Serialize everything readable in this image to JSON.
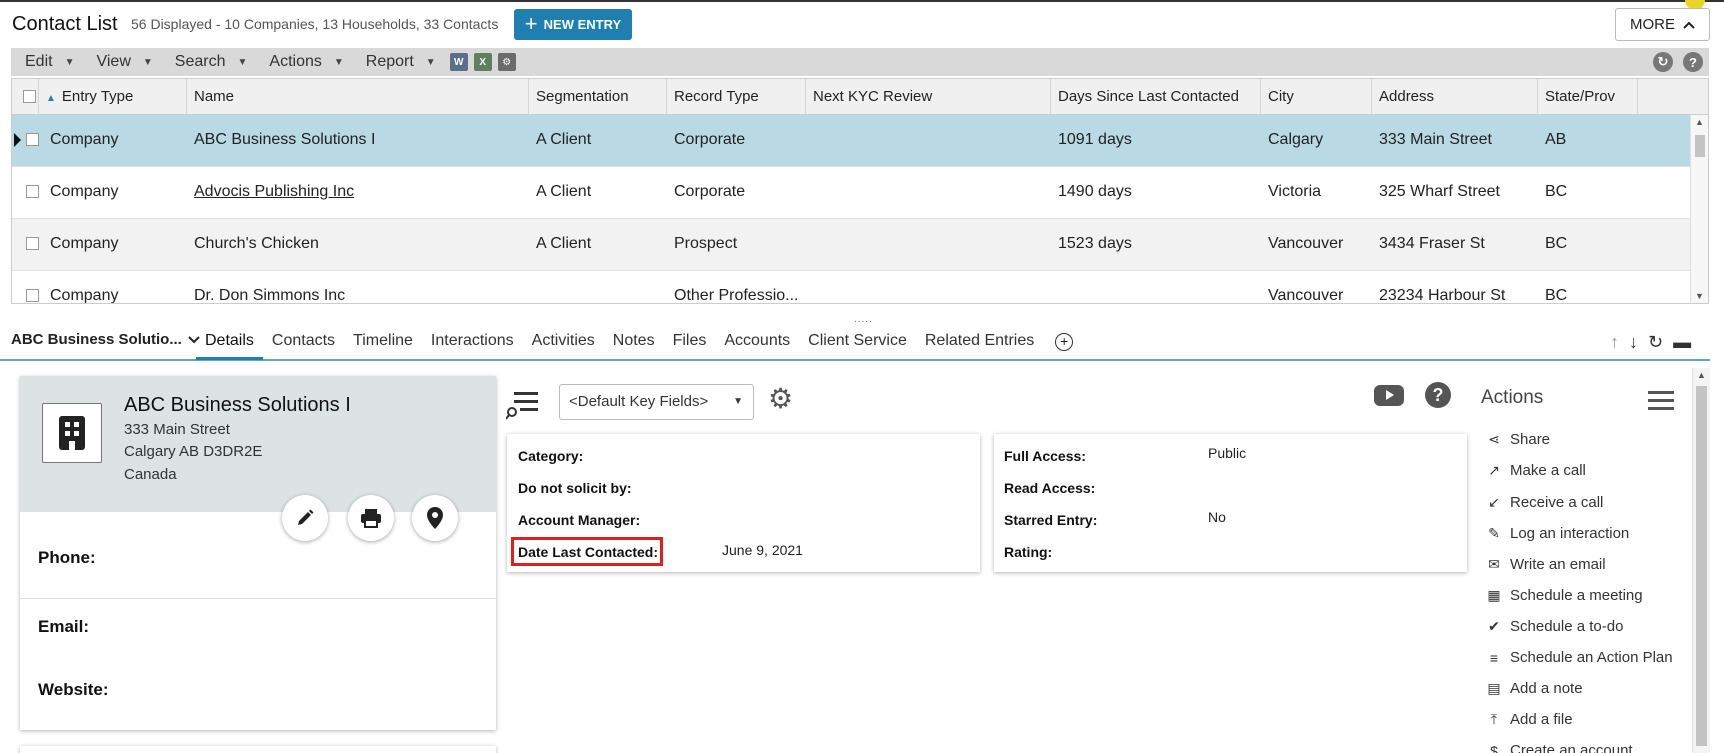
{
  "header": {
    "title": "Contact List",
    "subtitle": "56 Displayed - 10 Companies, 13 Households, 33 Contacts",
    "new_entry": "NEW ENTRY",
    "more": "MORE"
  },
  "menubar": {
    "items": [
      "Edit",
      "View",
      "Search",
      "Actions",
      "Report"
    ],
    "tool_icons": [
      "word-icon",
      "excel-icon",
      "merge-icon"
    ]
  },
  "grid": {
    "columns": [
      "Entry Type",
      "Name",
      "Segmentation",
      "Record Type",
      "Next KYC Review",
      "Days Since Last Contacted",
      "City",
      "Address",
      "State/Prov"
    ],
    "rows": [
      {
        "type": "Company",
        "name": "ABC Business Solutions I",
        "segmentation": "A Client",
        "record_type": "Corporate",
        "kyc": "",
        "days": "1091 days",
        "city": "Calgary",
        "address": "333 Main Street",
        "state": "AB"
      },
      {
        "type": "Company",
        "name": "Advocis Publishing Inc",
        "segmentation": "A Client",
        "record_type": "Corporate",
        "kyc": "",
        "days": "1490 days",
        "city": "Victoria",
        "address": "325 Wharf Street",
        "state": "BC"
      },
      {
        "type": "Company",
        "name": "Church's Chicken",
        "segmentation": "A Client",
        "record_type": "Prospect",
        "kyc": "",
        "days": "1523 days",
        "city": "Vancouver",
        "address": "3434 Fraser St",
        "state": "BC"
      },
      {
        "type": "Company",
        "name": "Dr. Don Simmons Inc",
        "segmentation": "",
        "record_type": "Other Professio...",
        "kyc": "",
        "days": "",
        "city": "Vancouver",
        "address": "23234 Harbour St",
        "state": "BC"
      }
    ]
  },
  "detail": {
    "entry_name": "ABC Business Solutio...",
    "tabs": [
      "Details",
      "Contacts",
      "Timeline",
      "Interactions",
      "Activities",
      "Notes",
      "Files",
      "Accounts",
      "Client Service",
      "Related Entries"
    ],
    "card": {
      "name": "ABC Business Solutions I",
      "address1": "333 Main Street",
      "address2": "Calgary AB D3DR2E",
      "country": "Canada",
      "phone_label": "Phone:",
      "email_label": "Email:",
      "website_label": "Website:"
    },
    "key_fields": "<Default Key Fields>",
    "panel_left": {
      "category": "Category:",
      "do_not_solicit": "Do not solicit by:",
      "account_manager": "Account Manager:",
      "date_last_contacted": "Date Last Contacted:",
      "date_last_contacted_value": "June 9, 2021"
    },
    "panel_right": {
      "full_access": "Full Access:",
      "full_access_value": "Public",
      "read_access": "Read Access:",
      "starred": "Starred Entry:",
      "starred_value": "No",
      "rating": "Rating:"
    },
    "actions_title": "Actions",
    "actions": [
      "Share",
      "Make a call",
      "Receive a call",
      "Log an interaction",
      "Write an email",
      "Schedule a meeting",
      "Schedule a to-do",
      "Schedule an Action Plan",
      "Add a note",
      "Add a file",
      "Create an account"
    ]
  }
}
